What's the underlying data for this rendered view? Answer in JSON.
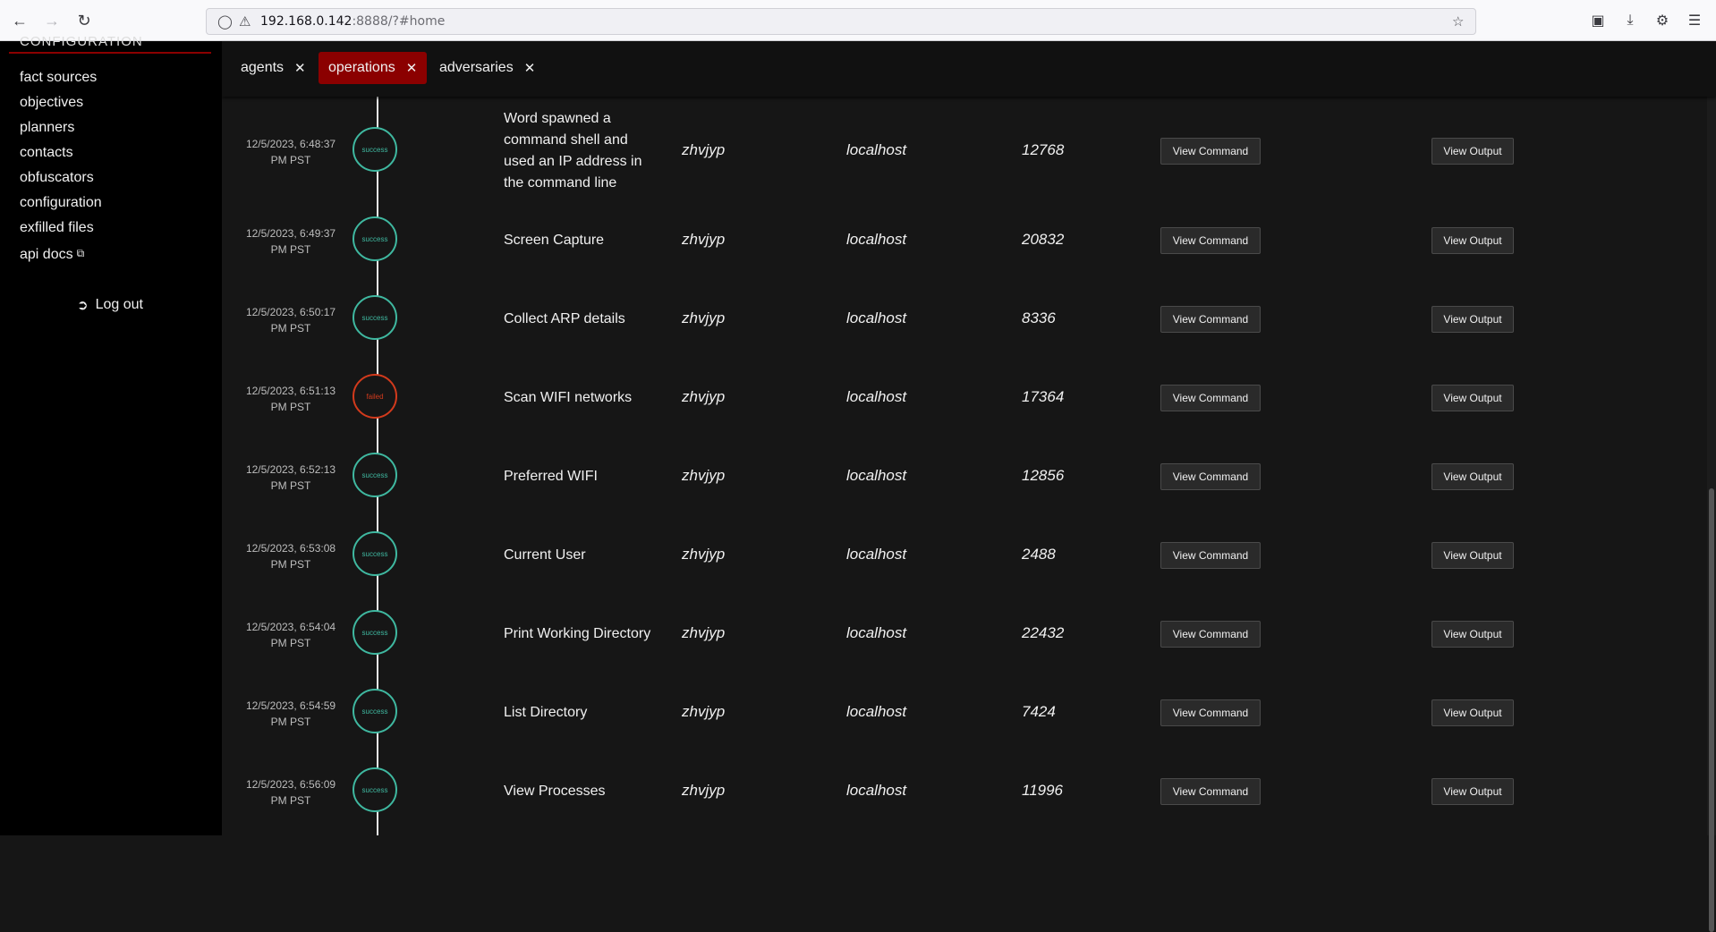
{
  "browser": {
    "url_host": "192.168.0.142",
    "url_rest": ":8888/?#home"
  },
  "sidebar": {
    "header_partial": "CONFIGURATION",
    "items": [
      {
        "label": "fact sources"
      },
      {
        "label": "objectives"
      },
      {
        "label": "planners"
      },
      {
        "label": "contacts"
      },
      {
        "label": "obfuscators"
      },
      {
        "label": "configuration"
      },
      {
        "label": "exfilled files"
      },
      {
        "label": "api docs"
      }
    ],
    "logout": "Log out"
  },
  "tabs": [
    {
      "label": "agents",
      "active": false
    },
    {
      "label": "operations",
      "active": true
    },
    {
      "label": "adversaries",
      "active": false
    }
  ],
  "buttons": {
    "view_command": "View Command",
    "view_output": "View Output"
  },
  "colors": {
    "accent": "#8b0000",
    "success": "#3fb8a0",
    "failed": "#d23a1c"
  },
  "links": [
    {
      "time": "12/5/2023, 6:48:37",
      "tz": "PM PST",
      "status": "success",
      "ability": "Word spawned a command shell and used an IP address in the command line",
      "agent": "zhvjyp",
      "host": "localhost",
      "pid": "12768"
    },
    {
      "time": "12/5/2023, 6:49:37",
      "tz": "PM PST",
      "status": "success",
      "ability": "Screen Capture",
      "agent": "zhvjyp",
      "host": "localhost",
      "pid": "20832"
    },
    {
      "time": "12/5/2023, 6:50:17",
      "tz": "PM PST",
      "status": "success",
      "ability": "Collect ARP details",
      "agent": "zhvjyp",
      "host": "localhost",
      "pid": "8336"
    },
    {
      "time": "12/5/2023, 6:51:13",
      "tz": "PM PST",
      "status": "failed",
      "ability": "Scan WIFI networks",
      "agent": "zhvjyp",
      "host": "localhost",
      "pid": "17364"
    },
    {
      "time": "12/5/2023, 6:52:13",
      "tz": "PM PST",
      "status": "success",
      "ability": "Preferred WIFI",
      "agent": "zhvjyp",
      "host": "localhost",
      "pid": "12856"
    },
    {
      "time": "12/5/2023, 6:53:08",
      "tz": "PM PST",
      "status": "success",
      "ability": "Current User",
      "agent": "zhvjyp",
      "host": "localhost",
      "pid": "2488"
    },
    {
      "time": "12/5/2023, 6:54:04",
      "tz": "PM PST",
      "status": "success",
      "ability": "Print Working Directory",
      "agent": "zhvjyp",
      "host": "localhost",
      "pid": "22432"
    },
    {
      "time": "12/5/2023, 6:54:59",
      "tz": "PM PST",
      "status": "success",
      "ability": "List Directory",
      "agent": "zhvjyp",
      "host": "localhost",
      "pid": "7424"
    },
    {
      "time": "12/5/2023, 6:56:09",
      "tz": "PM PST",
      "status": "success",
      "ability": "View Processes",
      "agent": "zhvjyp",
      "host": "localhost",
      "pid": "11996"
    }
  ]
}
